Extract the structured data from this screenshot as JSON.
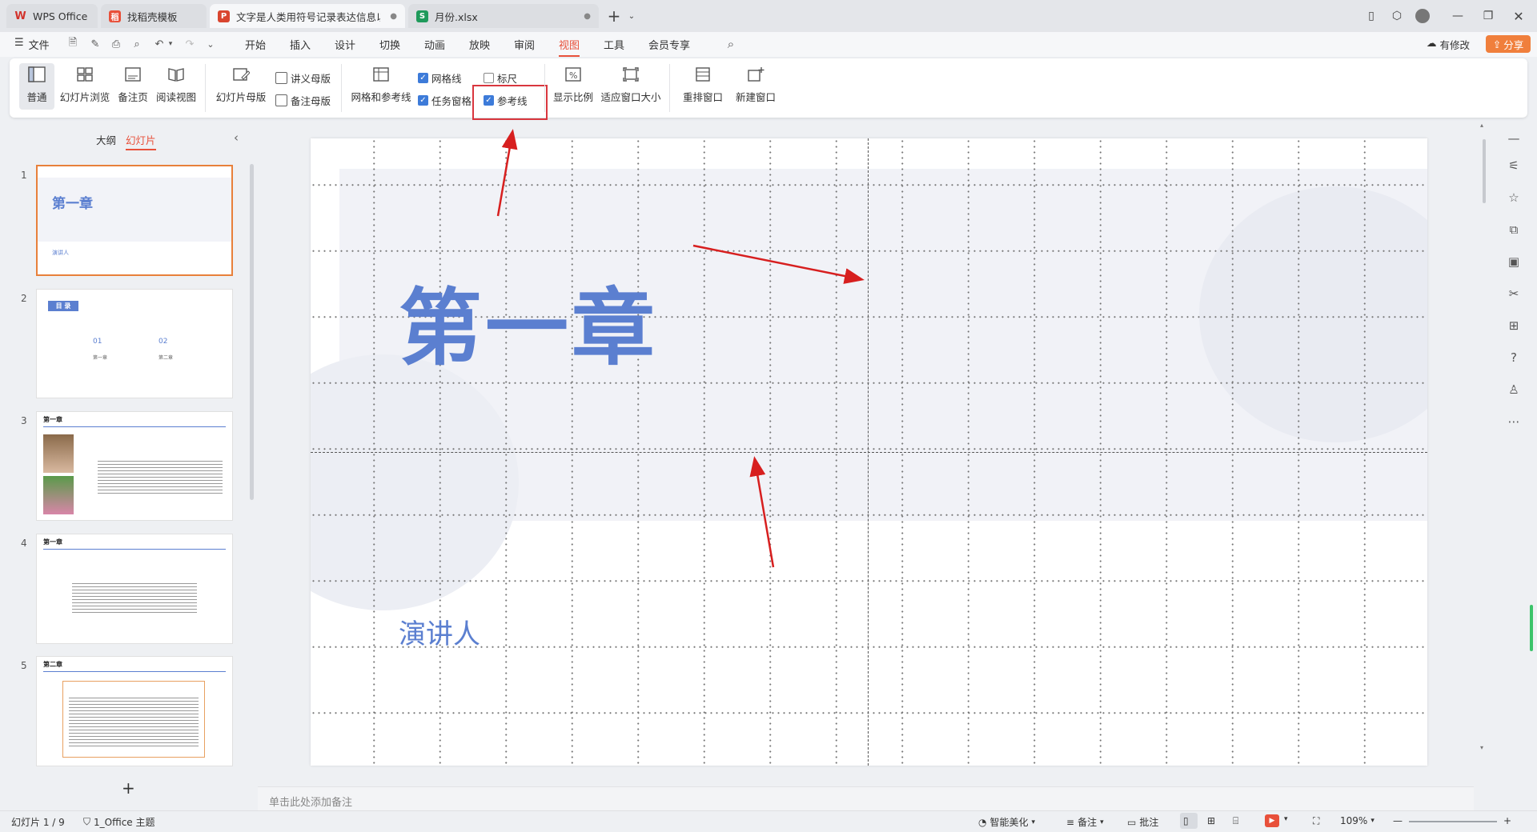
{
  "tabs": [
    {
      "label": "WPS Office",
      "icon": "wps-logo"
    },
    {
      "label": "找稻壳模板",
      "icon": "docer-icon"
    },
    {
      "label": "文字是人类用符号记录表达信息以",
      "icon": "ppt-icon",
      "active": true
    },
    {
      "label": "月份.xlsx",
      "icon": "excel-icon"
    }
  ],
  "menu": {
    "file": "文件",
    "items": [
      "开始",
      "插入",
      "设计",
      "切换",
      "动画",
      "放映",
      "审阅",
      "视图",
      "工具",
      "会员专享"
    ],
    "active": "视图",
    "modified": "有修改",
    "share": "分享"
  },
  "ribbon": {
    "normal": "普通",
    "sorter": "幻灯片浏览",
    "notes_page": "备注页",
    "reading": "阅读视图",
    "slide_master": "幻灯片母版",
    "handout_master": "讲义母版",
    "notes_master": "备注母版",
    "grid_guides": "网格和参考线",
    "gridlines": "网格线",
    "task_pane": "任务窗格",
    "ruler": "标尺",
    "guides": "参考线",
    "zoom": "显示比例",
    "fit_window": "适应窗口大小",
    "rearrange": "重排窗口",
    "new_window": "新建窗口"
  },
  "checks": {
    "gridlines": true,
    "task_pane": true,
    "ruler": false,
    "guides": true
  },
  "pane": {
    "outline": "大纲",
    "slides": "幻灯片",
    "active": "幻灯片"
  },
  "thumbs": {
    "t1_title": "第一章",
    "t1_sub": "演讲人",
    "t2_header": "目 录",
    "t2_a": "01",
    "t2_b": "02",
    "t2_a_sub": "第一章",
    "t2_b_sub": "第二章",
    "t3_title": "第一章",
    "t4_title": "第一章",
    "t5_title": "第二章"
  },
  "slide_numbers": [
    "1",
    "2",
    "3",
    "4",
    "5"
  ],
  "slide": {
    "title": "第一章",
    "subtitle": "演讲人"
  },
  "notes_placeholder": "单击此处添加备注",
  "status": {
    "slide_info": "幻灯片 1 / 9",
    "theme": "1_Office 主题",
    "beautify": "智能美化",
    "notes": "备注",
    "comments": "批注",
    "zoom": "109%"
  },
  "colors": {
    "accent": "#e8503a",
    "title_blue": "#5b7fd0",
    "highlight": "#d9363e",
    "arrow": "#d71f1f"
  }
}
